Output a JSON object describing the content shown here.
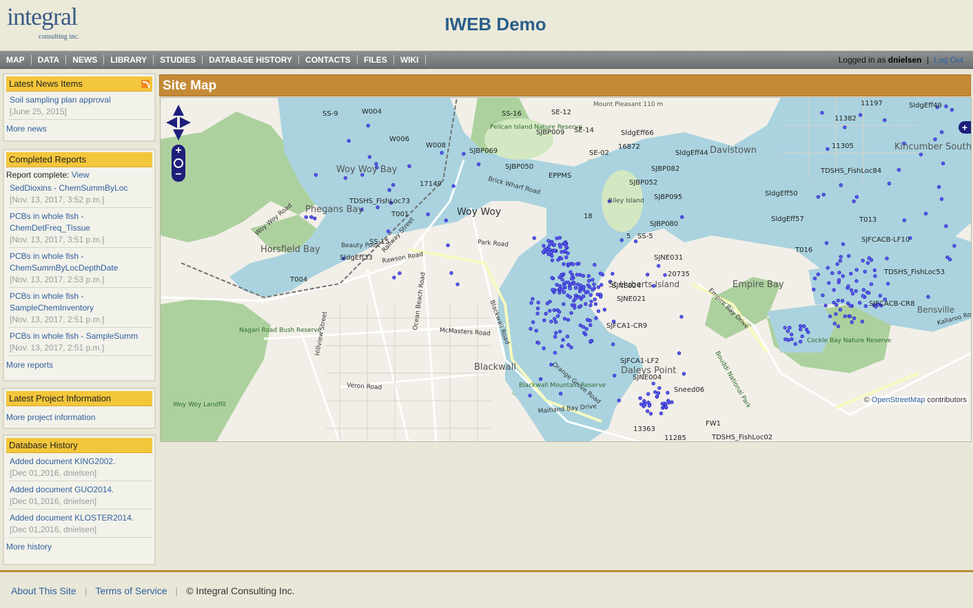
{
  "header": {
    "logo_word": "integral",
    "logo_sub": "consulting inc.",
    "title": "IWEB Demo"
  },
  "nav": {
    "items": [
      {
        "label": "MAP"
      },
      {
        "label": "DATA"
      },
      {
        "label": "NEWS"
      },
      {
        "label": "LIBRARY"
      },
      {
        "label": "STUDIES"
      },
      {
        "label": "DATABASE HISTORY"
      },
      {
        "label": "CONTACTS"
      },
      {
        "label": "FILES"
      },
      {
        "label": "WIKI"
      }
    ],
    "login_prefix": "Logged in as",
    "username": "dnielsen",
    "separator": "|",
    "logout": "Log Out"
  },
  "sidebar": {
    "news": {
      "title": "Latest News Items",
      "items": [
        {
          "title": "Soil sampling plan approval",
          "date": "[June 25, 2015]"
        }
      ],
      "more": "More news"
    },
    "reports": {
      "title": "Completed Reports",
      "note_prefix": "Report complete:",
      "note_link": "View",
      "items": [
        {
          "title": "SedDioxins - ChemSummByLoc",
          "date": "[Nov. 13, 2017, 3:52 p.m.]"
        },
        {
          "title": "PCBs in whole fish - ChemDetFreq_Tissue",
          "date": "[Nov. 13, 2017, 3:51 p.m.]"
        },
        {
          "title": "PCBs in whole fish - ChemSummByLocDepthDate",
          "date": "[Nov. 13, 2017, 2:53 p.m.]"
        },
        {
          "title": "PCBs in whole fish - SampleChemInventory",
          "date": "[Nov. 13, 2017, 2:51 p.m.]"
        },
        {
          "title": "PCBs in whole fish - SampleSumm",
          "date": "[Nov. 13, 2017, 2:51 p.m.]"
        }
      ],
      "more": "More reports"
    },
    "project": {
      "title": "Latest Project Information",
      "more": "More project information"
    },
    "history": {
      "title": "Database History",
      "items": [
        {
          "title": "Added document KING2002.",
          "date": "[Dec 01,2016, dnielsen]"
        },
        {
          "title": "Added document GUO2014.",
          "date": "[Dec 01,2016, dnielsen]"
        },
        {
          "title": "Added document KLOSTER2014.",
          "date": "[Dec 01,2016, dnielsen]"
        }
      ],
      "more": "More history"
    }
  },
  "main": {
    "title": "Site Map",
    "attribution_prefix": "©",
    "attribution_link": "OpenStreetMap",
    "attribution_suffix": "contributors"
  },
  "map": {
    "place_labels": [
      "Woy Woy Bay",
      "Phegans Bay",
      "Horsfield Bay",
      "Woy Woy",
      "Davistown",
      "Kincumber South",
      "Empire Bay",
      "Bensville",
      "Blackwall",
      "Daleys Point",
      "St Huberts Island",
      "Riley Island",
      "Pelican Island Nature Reserve",
      "Nagari Road Bush Reserve",
      "Woy Woy Landfill",
      "Blackwall Mountain Reserve",
      "Cockle Bay Nature Reserve",
      "Mount Pleasant 110 m"
    ],
    "road_labels": [
      "Woy Woy Road",
      "Brick Wharf Road",
      "Railway Street",
      "Rawson Road",
      "Park Road",
      "Blackwall Road",
      "McMasters Road",
      "Ocean Beach Road",
      "Veron Road",
      "Orange Grove Road",
      "Maitland Bay Drive",
      "Empire Bay Drive",
      "Bouddi National Park",
      "Hillview Street",
      "Kallaroo Road",
      "Beauty Point"
    ],
    "station_labels": [
      "SS-9",
      "W004",
      "W006",
      "W008",
      "SS-16",
      "SE-12",
      "SE-14",
      "SJBP009",
      "SJBP069",
      "SJBP050",
      "EPPMS",
      "SE-02",
      "16872",
      "SldgEff66",
      "SldgEff44",
      "SJBP082",
      "SJBP052",
      "SJBP095",
      "SldgEff50",
      "SldgEff57",
      "SJBP080",
      "18",
      "SS-5",
      "5",
      "SJNE031",
      "20735",
      "SJNE024",
      "SJNE021",
      "SJFCA1-CR9",
      "SJFCA1-LF2",
      "SJNE004",
      "Sneed06",
      "13363",
      "11285",
      "FW1",
      "TDSHS_FishLoc02",
      "17149",
      "TDSHS_FishLoc73",
      "T001",
      "SS-15",
      "SldgEff33",
      "T004",
      "11197",
      "SldgEff49",
      "11382",
      "11305",
      "TDSHS_FishLoc84",
      "T013",
      "T016",
      "SJFCACB-LF10",
      "TDSHS_FishLoc53",
      "SJFCACB-CR8"
    ]
  },
  "footer": {
    "about": "About This Site",
    "sep": "|",
    "terms": "Terms of Service",
    "copyright": "© Integral Consulting Inc."
  },
  "colors": {
    "accent": "#c58a36",
    "box_header": "#f3c63b",
    "link": "#2e5f9e",
    "water": "#aad3df",
    "sample_point": "#3a3ad8"
  }
}
